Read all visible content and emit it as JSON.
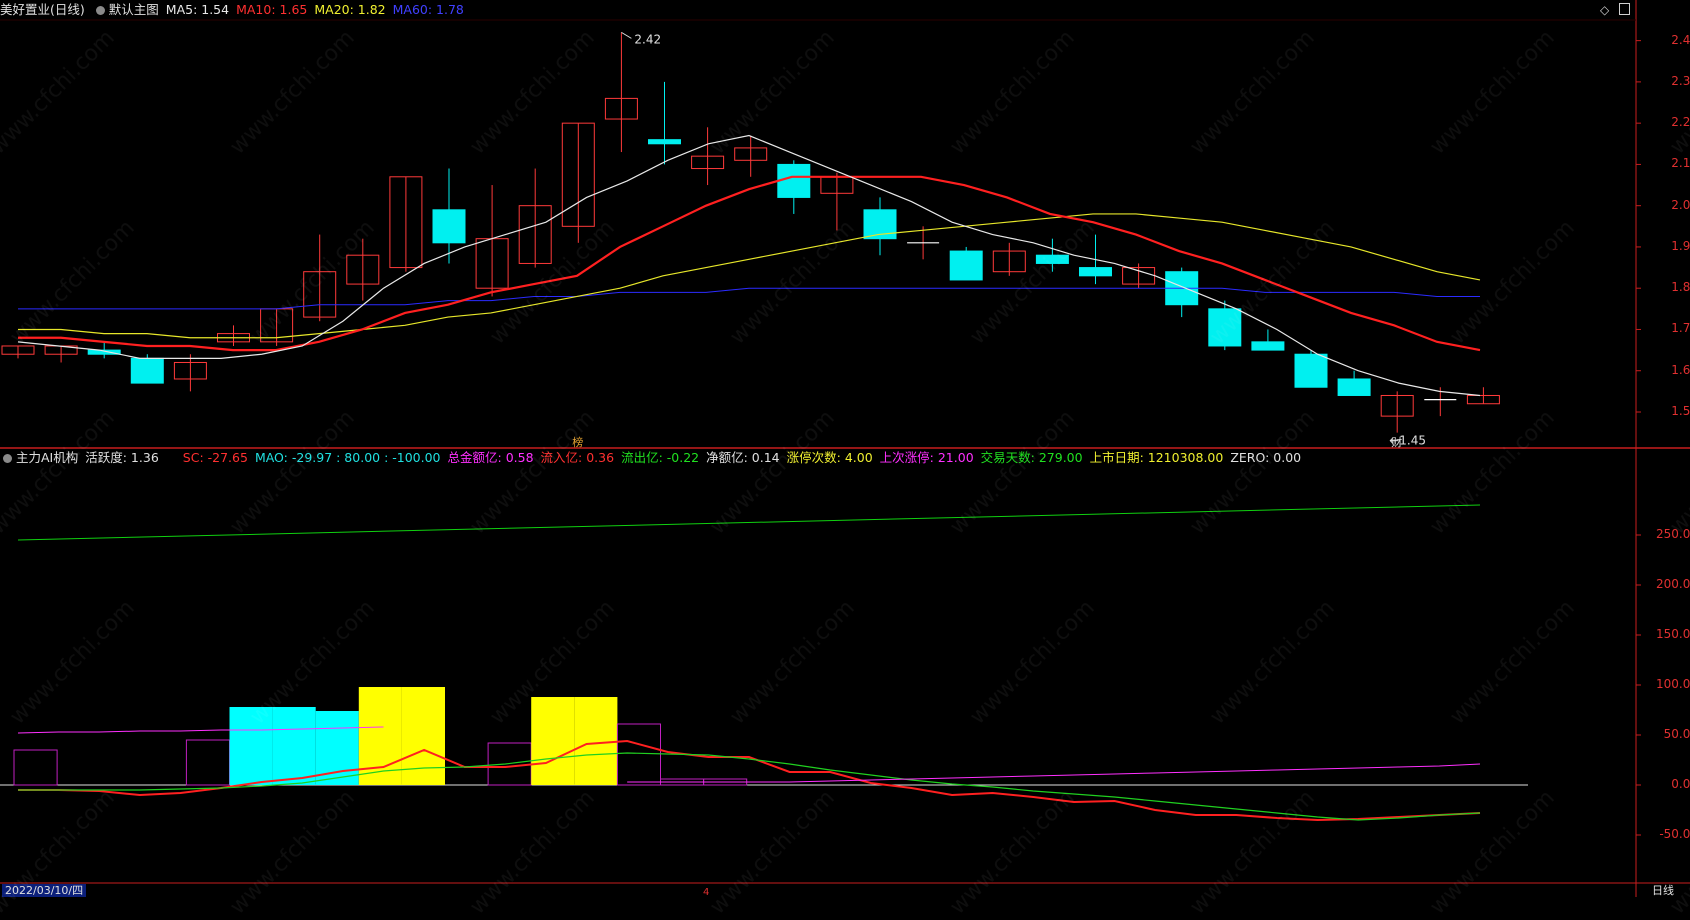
{
  "main_header": {
    "stock": "美好置业(日线)",
    "template": "默认主图",
    "ma5": "MA5: 1.54",
    "ma10": "MA10: 1.65",
    "ma20": "MA20: 1.82",
    "ma60": "MA60: 1.78"
  },
  "indicator_header": {
    "name": "主力AI机构",
    "activity": "活跃度: 1.36",
    "sc": "SC: -27.65",
    "mao": "MAO: -29.97 : 80.00 : -100.00",
    "total": "总金额亿: 0.58",
    "inflow": "流入亿: 0.36",
    "outflow": "流出亿: -0.22",
    "net": "净额亿: 0.14",
    "limit_up_count": "涨停次数: 4.00",
    "last_limit_up": "上次涨停: 21.00",
    "trade_days": "交易天数: 279.00",
    "listing_date": "上市日期: 1210308.00",
    "zero": "ZERO: 0.00"
  },
  "annotations": {
    "high": "2.42",
    "low": "1.45",
    "bang": "榜",
    "cai": "财",
    "mid_tick": "4"
  },
  "status_bar": {
    "date": "2022/03/10/四",
    "period": "日线"
  },
  "watermark": "www.cfchi.com",
  "colors": {
    "up": "#ff3a3a",
    "down": "#00f0f0",
    "ma5": "#e8e8e8",
    "ma10": "#ff2020",
    "ma20": "#e6e62a",
    "ma60": "#2b2bff",
    "axis": "#c81e1e"
  },
  "chart_data": [
    {
      "type": "candlestick",
      "title": "美好置业(日线)",
      "ylim": [
        1.42,
        2.45
      ],
      "y_ticks": [
        "2.40",
        "2.30",
        "2.20",
        "2.10",
        "2.00",
        "1.90",
        "1.80",
        "1.70",
        "1.60",
        "1.50"
      ],
      "candles": [
        {
          "o": 1.64,
          "h": 1.66,
          "l": 1.63,
          "c": 1.66
        },
        {
          "o": 1.64,
          "h": 1.66,
          "l": 1.62,
          "c": 1.66
        },
        {
          "o": 1.65,
          "h": 1.67,
          "l": 1.63,
          "c": 1.64
        },
        {
          "o": 1.63,
          "h": 1.64,
          "l": 1.57,
          "c": 1.57
        },
        {
          "o": 1.58,
          "h": 1.64,
          "l": 1.55,
          "c": 1.62
        },
        {
          "o": 1.67,
          "h": 1.71,
          "l": 1.66,
          "c": 1.69
        },
        {
          "o": 1.67,
          "h": 1.75,
          "l": 1.66,
          "c": 1.75
        },
        {
          "o": 1.73,
          "h": 1.93,
          "l": 1.72,
          "c": 1.84
        },
        {
          "o": 1.81,
          "h": 1.92,
          "l": 1.77,
          "c": 1.88
        },
        {
          "o": 1.85,
          "h": 2.07,
          "l": 1.84,
          "c": 2.07
        },
        {
          "o": 1.99,
          "h": 2.09,
          "l": 1.86,
          "c": 1.91
        },
        {
          "o": 1.8,
          "h": 2.05,
          "l": 1.78,
          "c": 1.92
        },
        {
          "o": 1.86,
          "h": 2.09,
          "l": 1.85,
          "c": 2.0
        },
        {
          "o": 1.95,
          "h": 2.2,
          "l": 1.91,
          "c": 2.2
        },
        {
          "o": 2.21,
          "h": 2.42,
          "l": 2.13,
          "c": 2.26
        },
        {
          "o": 2.16,
          "h": 2.3,
          "l": 2.1,
          "c": 2.15
        },
        {
          "o": 2.09,
          "h": 2.19,
          "l": 2.05,
          "c": 2.12
        },
        {
          "o": 2.11,
          "h": 2.17,
          "l": 2.07,
          "c": 2.14
        },
        {
          "o": 2.1,
          "h": 2.11,
          "l": 1.98,
          "c": 2.02
        },
        {
          "o": 2.03,
          "h": 2.08,
          "l": 1.94,
          "c": 2.07
        },
        {
          "o": 1.99,
          "h": 2.02,
          "l": 1.88,
          "c": 1.92
        },
        {
          "o": 1.91,
          "h": 1.95,
          "l": 1.87,
          "c": 1.91
        },
        {
          "o": 1.89,
          "h": 1.9,
          "l": 1.82,
          "c": 1.82
        },
        {
          "o": 1.84,
          "h": 1.91,
          "l": 1.83,
          "c": 1.89
        },
        {
          "o": 1.88,
          "h": 1.92,
          "l": 1.84,
          "c": 1.86
        },
        {
          "o": 1.85,
          "h": 1.93,
          "l": 1.81,
          "c": 1.83
        },
        {
          "o": 1.81,
          "h": 1.86,
          "l": 1.8,
          "c": 1.85
        },
        {
          "o": 1.84,
          "h": 1.85,
          "l": 1.73,
          "c": 1.76
        },
        {
          "o": 1.75,
          "h": 1.77,
          "l": 1.65,
          "c": 1.66
        },
        {
          "o": 1.67,
          "h": 1.7,
          "l": 1.65,
          "c": 1.65
        },
        {
          "o": 1.64,
          "h": 1.65,
          "l": 1.56,
          "c": 1.56
        },
        {
          "o": 1.58,
          "h": 1.6,
          "l": 1.54,
          "c": 1.54
        },
        {
          "o": 1.49,
          "h": 1.55,
          "l": 1.45,
          "c": 1.54
        },
        {
          "o": 1.53,
          "h": 1.56,
          "l": 1.49,
          "c": 1.53
        },
        {
          "o": 1.52,
          "h": 1.56,
          "l": 1.52,
          "c": 1.54
        }
      ],
      "ma5": [
        1.67,
        1.66,
        1.65,
        1.63,
        1.63,
        1.63,
        1.64,
        1.66,
        1.72,
        1.8,
        1.86,
        1.9,
        1.93,
        1.96,
        2.02,
        2.06,
        2.11,
        2.15,
        2.17,
        2.13,
        2.09,
        2.05,
        2.01,
        1.96,
        1.93,
        1.91,
        1.88,
        1.86,
        1.83,
        1.79,
        1.75,
        1.7,
        1.64,
        1.6,
        1.57,
        1.55,
        1.54
      ],
      "ma10": [
        1.68,
        1.68,
        1.67,
        1.66,
        1.66,
        1.65,
        1.65,
        1.67,
        1.7,
        1.74,
        1.76,
        1.79,
        1.81,
        1.83,
        1.9,
        1.95,
        2.0,
        2.04,
        2.07,
        2.07,
        2.07,
        2.07,
        2.05,
        2.02,
        1.98,
        1.96,
        1.93,
        1.89,
        1.86,
        1.82,
        1.78,
        1.74,
        1.71,
        1.67,
        1.65
      ],
      "ma20": [
        1.7,
        1.7,
        1.69,
        1.69,
        1.68,
        1.68,
        1.68,
        1.69,
        1.7,
        1.71,
        1.73,
        1.74,
        1.76,
        1.78,
        1.8,
        1.83,
        1.85,
        1.87,
        1.89,
        1.91,
        1.93,
        1.94,
        1.95,
        1.96,
        1.97,
        1.98,
        1.98,
        1.97,
        1.96,
        1.94,
        1.92,
        1.9,
        1.87,
        1.84,
        1.82
      ],
      "ma60": [
        1.75,
        1.75,
        1.75,
        1.75,
        1.75,
        1.75,
        1.75,
        1.76,
        1.76,
        1.76,
        1.77,
        1.77,
        1.78,
        1.78,
        1.79,
        1.79,
        1.79,
        1.8,
        1.8,
        1.8,
        1.8,
        1.8,
        1.8,
        1.8,
        1.8,
        1.8,
        1.8,
        1.8,
        1.8,
        1.79,
        1.79,
        1.79,
        1.79,
        1.78,
        1.78
      ]
    },
    {
      "type": "bar",
      "title": "主力AI机构",
      "ylim": [
        -95,
        315
      ],
      "y_ticks": [
        "250.00",
        "200.00",
        "150.00",
        "100.00",
        "50.00",
        "0.00",
        "-50.00"
      ],
      "bars": [
        {
          "v": 35,
          "fill": false,
          "color": "#c020c0"
        },
        {
          "v": 0,
          "fill": false,
          "color": "#c020c0"
        },
        {
          "v": 0,
          "fill": false,
          "color": "#c020c0"
        },
        {
          "v": 0,
          "fill": false,
          "color": "#c020c0"
        },
        {
          "v": 45,
          "fill": false,
          "color": "#c020c0"
        },
        {
          "v": 78,
          "fill": true,
          "color": "#00ffff"
        },
        {
          "v": 78,
          "fill": true,
          "color": "#00ffff"
        },
        {
          "v": 74,
          "fill": true,
          "color": "#00ffff"
        },
        {
          "v": 98,
          "fill": true,
          "color": "#ffff00"
        },
        {
          "v": 98,
          "fill": true,
          "color": "#ffff00"
        },
        {
          "v": 0,
          "fill": false,
          "color": "#c020c0"
        },
        {
          "v": 42,
          "fill": false,
          "color": "#c020c0"
        },
        {
          "v": 88,
          "fill": true,
          "color": "#ffff00"
        },
        {
          "v": 88,
          "fill": true,
          "color": "#ffff00"
        },
        {
          "v": 61,
          "fill": false,
          "color": "#c020c0"
        },
        {
          "v": 6,
          "fill": false,
          "color": "#c020c0"
        },
        {
          "v": 6,
          "fill": false,
          "color": "#c020c0"
        }
      ],
      "series": [
        {
          "name": "SC",
          "color": "#ff2020",
          "values": [
            -5,
            -5,
            -6,
            -10,
            -8,
            -3,
            3,
            7,
            14,
            18,
            35,
            18,
            18,
            22,
            41,
            44,
            33,
            28,
            28,
            13,
            13,
            2,
            -3,
            -10,
            -8,
            -12,
            -17,
            -16,
            -25,
            -30,
            -30,
            -33,
            -35,
            -34,
            -32,
            -30,
            -28
          ]
        },
        {
          "name": "MAO",
          "color": "#20d020",
          "values": [
            -5,
            -5,
            -5,
            -5,
            -4,
            -3,
            -1,
            2,
            8,
            14,
            17,
            18,
            21,
            26,
            30,
            32,
            31,
            30,
            26,
            21,
            15,
            10,
            5,
            1,
            -2,
            -6,
            -9,
            -12,
            -16,
            -20,
            -24,
            -28,
            -32,
            -35,
            -33,
            -30,
            -28
          ]
        },
        {
          "name": "流入",
          "color": "#ff30ff",
          "values": [
            52,
            53,
            53,
            54,
            54,
            55,
            55,
            56,
            57,
            58,
            null,
            null,
            null,
            null,
            null,
            3,
            3,
            3,
            3,
            3,
            4,
            5,
            6,
            7,
            8,
            9,
            10,
            11,
            12,
            13,
            14,
            15,
            16,
            17,
            18,
            19,
            21
          ]
        },
        {
          "name": "交易天数",
          "color": "#10d010",
          "values": [
            245,
            280
          ]
        }
      ]
    }
  ]
}
